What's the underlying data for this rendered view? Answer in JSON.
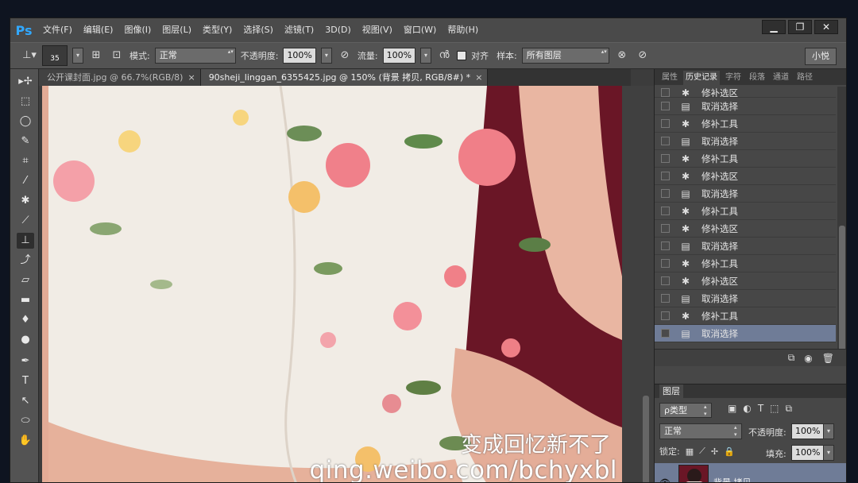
{
  "app": {
    "logo": "Ps"
  },
  "menu": [
    "文件(F)",
    "编辑(E)",
    "图像(I)",
    "图层(L)",
    "类型(Y)",
    "选择(S)",
    "滤镜(T)",
    "3D(D)",
    "视图(V)",
    "窗口(W)",
    "帮助(H)"
  ],
  "window_buttons": {
    "minimize": "▁",
    "restore": "❐",
    "close": "✕"
  },
  "options": {
    "brush_size": "35",
    "mode_label": "模式:",
    "mode_value": "正常",
    "opacity_label": "不透明度:",
    "opacity_value": "100%",
    "flow_label": "流量:",
    "flow_value": "100%",
    "align_label": "对齐",
    "sample_label": "样本:",
    "sample_value": "所有图层",
    "user_label": "小悦"
  },
  "tabs": [
    {
      "label": "公开课封面.jpg @ 66.7%(RGB/8)",
      "close": "×"
    },
    {
      "label": "90sheji_linggan_6355425.jpg @ 150% (背景 拷贝, RGB/8#) *",
      "close": "×"
    }
  ],
  "tools": [
    "move-icon",
    "marquee-icon",
    "lasso-icon",
    "quick-select-icon",
    "crop-icon",
    "eyedropper-icon",
    "healing-icon",
    "brush-icon",
    "clone-stamp-icon",
    "history-brush-icon",
    "eraser-icon",
    "gradient-icon",
    "blur-icon",
    "dodge-icon",
    "pen-icon",
    "type-icon",
    "path-select-icon",
    "shape-icon",
    "hand-icon"
  ],
  "tool_glyphs": {
    "move": "▸✢",
    "marquee": "⬚",
    "lasso": "◯",
    "quick_select": "✎",
    "crop": "⌗",
    "eyedropper": "⁄",
    "healing": "✱",
    "brush": "⟋",
    "clone_stamp": "⊥",
    "history_brush": "⤴",
    "eraser": "▱",
    "gradient": "▬",
    "blur": "♦",
    "dodge": "●",
    "pen": "✒",
    "type": "T",
    "path_select": "↖",
    "shape": "⬭",
    "hand": "✋"
  },
  "watermark": {
    "line1": "变成回忆新不了",
    "line2": "qing.weibo.com/bchyxbl"
  },
  "panel": {
    "tabs": [
      "属性",
      "历史记录",
      "字符",
      "段落",
      "通道",
      "路径"
    ],
    "history": [
      {
        "icon": "patch-icon",
        "label": "修补选区"
      },
      {
        "icon": "doc-icon",
        "label": "取消选择"
      },
      {
        "icon": "patch-icon",
        "label": "修补工具"
      },
      {
        "icon": "doc-icon",
        "label": "取消选择"
      },
      {
        "icon": "patch-icon",
        "label": "修补工具"
      },
      {
        "icon": "patch-icon",
        "label": "修补选区"
      },
      {
        "icon": "doc-icon",
        "label": "取消选择"
      },
      {
        "icon": "patch-icon",
        "label": "修补工具"
      },
      {
        "icon": "patch-icon",
        "label": "修补选区"
      },
      {
        "icon": "doc-icon",
        "label": "取消选择"
      },
      {
        "icon": "patch-icon",
        "label": "修补工具"
      },
      {
        "icon": "patch-icon",
        "label": "修补选区"
      },
      {
        "icon": "doc-icon",
        "label": "取消选择"
      },
      {
        "icon": "patch-icon",
        "label": "修补工具"
      },
      {
        "icon": "doc-icon",
        "label": "取消选择"
      }
    ],
    "history_footer": {
      "new_doc": "⧉",
      "snapshot": "◉",
      "trash": "🗑"
    },
    "layers_title": "图层",
    "filter_label": "ρ类型",
    "blend_value": "正常",
    "opacity_label": "不透明度:",
    "opacity_value": "100%",
    "lock_label": "锁定:",
    "fill_label": "填充:",
    "fill_value": "100%",
    "layer_name": "背景 拷贝",
    "eye": "👁"
  },
  "colors": {
    "accent": "#31a8ff",
    "selection": "#6f7c97",
    "backdrop": "#6a1626"
  }
}
